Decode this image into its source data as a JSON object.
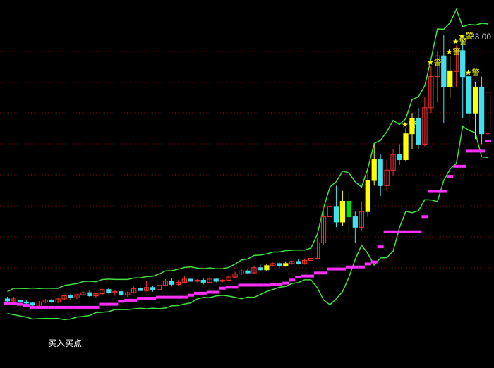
{
  "chart_data": {
    "type": "candlestick",
    "price_label": "33.00",
    "buy_signal_label": "买入买点",
    "warning_marker": "警",
    "colors": {
      "background": "#000000",
      "grid": "#8b0000",
      "up_candle": "#ff3030",
      "down_candle": "#40e0f0",
      "highlight_candle": "#ffff00",
      "highlight_down": "#00e000",
      "upper_band": "#40e040",
      "lower_band": "#40e040",
      "support_line": "#ff30ff",
      "star": "#ffff00"
    },
    "y_range": [
      4,
      34
    ],
    "candles": [
      [
        7.6,
        7.4,
        7.8,
        7.2
      ],
      [
        7.4,
        7.6,
        7.8,
        7.3
      ],
      [
        7.5,
        7.3,
        7.6,
        7.1
      ],
      [
        7.3,
        7.2,
        7.5,
        7.0
      ],
      [
        7.2,
        7.0,
        7.3,
        6.9
      ],
      [
        7.0,
        7.3,
        7.4,
        6.8
      ],
      [
        7.3,
        7.5,
        7.6,
        7.2
      ],
      [
        7.5,
        7.3,
        7.7,
        7.2
      ],
      [
        7.3,
        7.6,
        7.7,
        7.2
      ],
      [
        7.6,
        7.9,
        8.0,
        7.5
      ],
      [
        7.9,
        7.7,
        8.1,
        7.5
      ],
      [
        7.7,
        8.0,
        8.1,
        7.6
      ],
      [
        8.0,
        8.2,
        8.3,
        7.9
      ],
      [
        8.2,
        7.9,
        8.4,
        7.8
      ],
      [
        7.9,
        8.1,
        8.2,
        7.7
      ],
      [
        8.1,
        8.5,
        8.6,
        8.0
      ],
      [
        8.5,
        8.2,
        8.7,
        8.1
      ],
      [
        8.2,
        8.3,
        8.4,
        7.9
      ],
      [
        8.3,
        8.0,
        8.5,
        7.9
      ],
      [
        8.0,
        8.2,
        8.3,
        7.8
      ],
      [
        8.2,
        8.6,
        8.8,
        8.1
      ],
      [
        8.6,
        8.4,
        8.9,
        8.3
      ],
      [
        8.4,
        8.7,
        9.3,
        8.3
      ],
      [
        8.7,
        8.5,
        8.9,
        8.3
      ],
      [
        8.5,
        8.9,
        9.0,
        8.4
      ],
      [
        8.9,
        9.3,
        9.5,
        8.8
      ],
      [
        9.3,
        9.0,
        9.6,
        8.8
      ],
      [
        9.0,
        9.2,
        9.4,
        8.9
      ],
      [
        9.2,
        9.5,
        9.8,
        9.1
      ],
      [
        9.5,
        9.3,
        9.7,
        9.1
      ],
      [
        9.3,
        9.4,
        9.5,
        9.2
      ],
      [
        9.4,
        9.2,
        9.6,
        9.0
      ],
      [
        9.2,
        9.5,
        9.7,
        9.1
      ],
      [
        9.5,
        9.3,
        9.6,
        9.2
      ],
      [
        9.3,
        9.4,
        9.5,
        9.2
      ],
      [
        9.4,
        9.7,
        9.9,
        9.3
      ],
      [
        9.7,
        10.0,
        10.2,
        9.6
      ],
      [
        10.0,
        10.3,
        10.5,
        9.9
      ],
      [
        10.3,
        10.1,
        10.5,
        10.0
      ],
      [
        10.1,
        10.6,
        10.8,
        10.0
      ],
      [
        10.6,
        10.4,
        10.9,
        10.3
      ],
      [
        10.4,
        10.8,
        11.0,
        10.3
      ],
      [
        10.8,
        11.0,
        11.1,
        10.7
      ],
      [
        11.0,
        10.8,
        11.2,
        10.6
      ],
      [
        10.8,
        11.0,
        11.2,
        10.7
      ],
      [
        11.0,
        11.2,
        11.3,
        10.9
      ],
      [
        11.2,
        11.0,
        11.4,
        10.9
      ],
      [
        11.0,
        11.3,
        11.5,
        10.9
      ],
      [
        11.3,
        11.5,
        12.5,
        11.2
      ],
      [
        11.5,
        13.0,
        13.5,
        11.4
      ],
      [
        13.0,
        15.5,
        16.5,
        12.8
      ],
      [
        15.5,
        16.5,
        17.5,
        15.0
      ],
      [
        16.5,
        15.0,
        18.5,
        14.5
      ],
      [
        15.0,
        17.0,
        18.0,
        14.6
      ],
      [
        17.0,
        15.5,
        17.8,
        14.0
      ],
      [
        15.5,
        14.5,
        16.0,
        13.0
      ],
      [
        14.5,
        16.0,
        17.0,
        14.2
      ],
      [
        16.0,
        19.0,
        20.0,
        15.5
      ],
      [
        19.0,
        21.0,
        22.5,
        18.5
      ],
      [
        21.0,
        18.5,
        21.5,
        17.5
      ],
      [
        18.5,
        20.0,
        21.0,
        18.0
      ],
      [
        20.0,
        21.5,
        22.0,
        19.5
      ],
      [
        21.5,
        21.0,
        22.5,
        20.5
      ],
      [
        21.0,
        23.5,
        24.0,
        20.8
      ],
      [
        23.5,
        25.0,
        25.5,
        22.0
      ],
      [
        25.0,
        22.5,
        26.0,
        22.0
      ],
      [
        22.5,
        26.0,
        27.0,
        22.3
      ],
      [
        26.0,
        29.0,
        30.0,
        25.5
      ],
      [
        29.0,
        31.0,
        31.5,
        26.5
      ],
      [
        31.0,
        28.0,
        33.0,
        24.5
      ],
      [
        28.0,
        29.5,
        31.0,
        27.0
      ],
      [
        29.5,
        31.5,
        32.0,
        28.0
      ],
      [
        31.5,
        29.0,
        32.5,
        25.0
      ],
      [
        29.0,
        25.5,
        29.0,
        24.5
      ],
      [
        25.5,
        28.0,
        28.5,
        23.0
      ],
      [
        28.0,
        23.5,
        29.0,
        22.5
      ],
      [
        23.5,
        27.5,
        30.5,
        23.0
      ]
    ],
    "highlight_indices": [
      41,
      44,
      53,
      54,
      57,
      58,
      63,
      64,
      70,
      74
    ],
    "green_indices": [
      54
    ],
    "warning_indices": [
      63,
      67,
      70,
      71,
      72,
      73
    ]
  }
}
